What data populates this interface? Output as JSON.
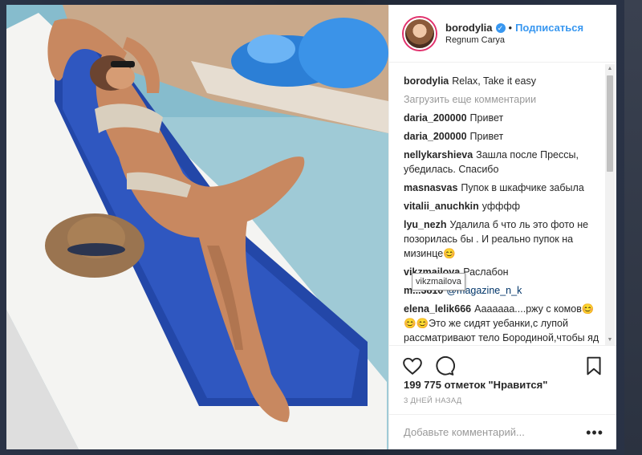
{
  "post": {
    "username": "borodylia",
    "follow_label": "Подписаться",
    "location": "Regnum Carya",
    "likes_text": "199 775 отметок \"Нравится\"",
    "time_ago": "3 ДНЕЙ НАЗАД",
    "add_comment_placeholder": "Добавьте комментарий...",
    "more_label": "•••"
  },
  "caption": {
    "user": "borodylia",
    "text": "Relax, Take it easy"
  },
  "load_more": "Загрузить еще комментарии",
  "comments": [
    {
      "user": "daria_200000",
      "text": "Привет"
    },
    {
      "user": "daria_200000",
      "text": "Привет"
    },
    {
      "user": "nellykarshieva",
      "text": "Зашла после Прессы, убедилась. Спасибо"
    },
    {
      "user": "masnasvas",
      "text": "Пупок в шкафчике забыла"
    },
    {
      "user": "vitalii_anuchkin",
      "text": "уфффф"
    },
    {
      "user": "lyu_nezh",
      "text": "Удалила б что ль это фото не позорилась бы . И реально пупок на мизинце😊"
    },
    {
      "user": "vikzmailova",
      "text": "Раслабон"
    },
    {
      "user": "m...3810",
      "text": "@magazine_n_k"
    },
    {
      "user": "elena_lelik666",
      "text": "Ааааааа....ржу с комов😊 😊😊Это же сидят уебанки,с лупой рассматривают тело Бородиной,чтобы яд свой очередной выплеснуть"
    }
  ],
  "tooltip": "vikzmailova",
  "icons": {
    "like": "heart-icon",
    "comment": "comment-icon",
    "save": "bookmark-icon",
    "verified": "verified-badge-icon"
  },
  "colors": {
    "accent": "#3897f0",
    "text": "#262626",
    "muted": "#999999"
  }
}
